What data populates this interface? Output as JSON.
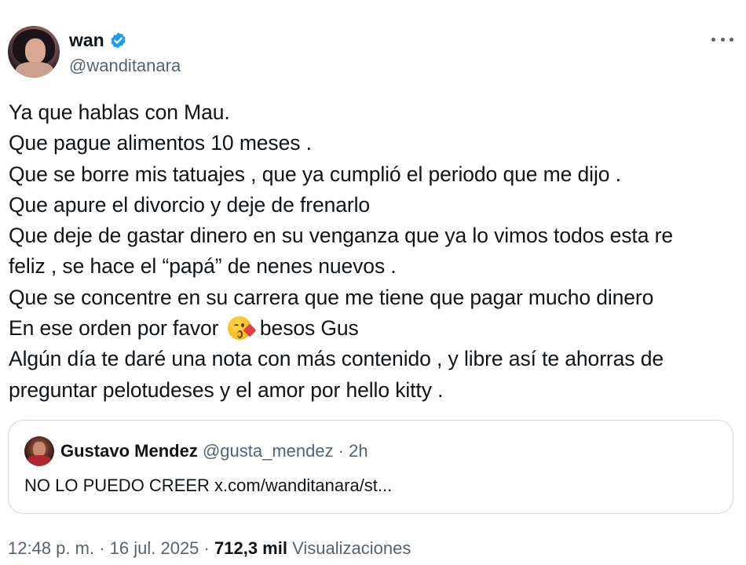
{
  "author": {
    "name": "wan",
    "handle": "@wanditanara",
    "verified_color": "#1d9bf0"
  },
  "tweet": {
    "lines": [
      "Ya que hablas con Mau.",
      "Que pague alimentos 10 meses .",
      "Que se borre mis tatuajes , que ya cumplió el periodo que me dijo .",
      "Que apure el divorcio y deje de frenarlo",
      "Que deje de gastar dinero en su venganza que ya lo vimos todos esta re",
      "feliz , se hace el “papá” de nenes nuevos .",
      "Que se concentre en su carrera que me tiene que pagar mucho dinero",
      "En ese orden por favor",
      "besos Gus",
      "Algún día te daré una nota con más contenido , y libre así te ahorras de",
      "preguntar pelotudeses y el amor por hello kitty ."
    ],
    "emoji": "face-blowing-a-kiss"
  },
  "quote": {
    "name": "Gustavo Mendez",
    "handle": "@gusta_mendez",
    "separator": "·",
    "time": "2h",
    "text": "NO LO PUEDO CREER x.com/wanditanara/st..."
  },
  "footer": {
    "time": "12:48 p. m.",
    "sep1": "·",
    "date": "16 jul. 2025",
    "sep2": "·",
    "views_count": "712,3 mil",
    "views_label": "Visualizaciones"
  }
}
